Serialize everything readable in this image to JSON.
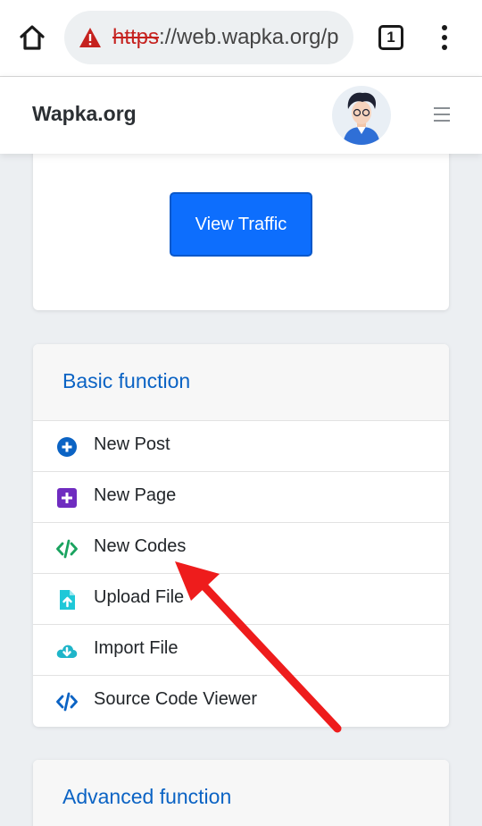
{
  "browser": {
    "url_scheme": "https",
    "url_rest": "://web.wapka.org/p",
    "tab_count": "1",
    "icons": [
      "home-icon",
      "warning-icon",
      "tabs-icon",
      "more-vert-icon"
    ]
  },
  "site": {
    "brand": "Wapka.org",
    "icons": [
      "avatar",
      "hamburger-icon"
    ]
  },
  "top_card": {
    "button_label": "View Traffic"
  },
  "basic": {
    "title": "Basic function",
    "items": [
      {
        "label": "New Post",
        "icon": "plus-circle-icon",
        "color": "#0b63c4"
      },
      {
        "label": "New Page",
        "icon": "plus-square-icon",
        "color": "#6f2cc0"
      },
      {
        "label": "New Codes",
        "icon": "code-icon",
        "color": "#1aa35f"
      },
      {
        "label": "Upload File",
        "icon": "file-upload-icon",
        "color": "#1fc8d8"
      },
      {
        "label": "Import File",
        "icon": "cloud-download-icon",
        "color": "#1fb5c9"
      },
      {
        "label": "Source Code Viewer",
        "icon": "code-icon",
        "color": "#0b63c4"
      }
    ]
  },
  "advanced": {
    "title": "Advanced function"
  },
  "colors": {
    "primary": "#0d6efd",
    "title_blue": "#0b63c4",
    "annotation_red": "#ee1c1c"
  }
}
